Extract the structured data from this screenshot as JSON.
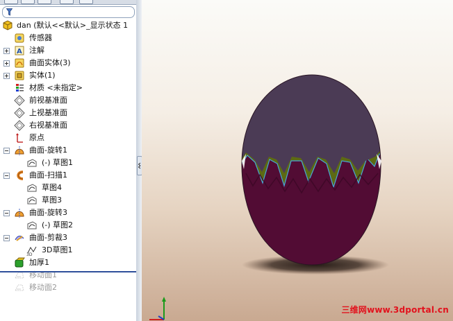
{
  "tree": {
    "root": "dan  (默认<<默认>_显示状态 1",
    "items": [
      {
        "label": "传感器",
        "icon": "sensor-icon",
        "expander": "none",
        "indent": 0
      },
      {
        "label": "注解",
        "icon": "annotation-icon",
        "expander": "plus",
        "indent": 0
      },
      {
        "label": "曲面实体(3)",
        "icon": "surface-bodies-icon",
        "expander": "plus",
        "indent": 0
      },
      {
        "label": "实体(1)",
        "icon": "solid-bodies-icon",
        "expander": "plus",
        "indent": 0
      },
      {
        "label": "材质 <未指定>",
        "icon": "material-icon",
        "expander": "none",
        "indent": 0
      },
      {
        "label": "前视基准面",
        "icon": "plane-icon",
        "expander": "none",
        "indent": 0
      },
      {
        "label": "上视基准面",
        "icon": "plane-icon",
        "expander": "none",
        "indent": 0
      },
      {
        "label": "右视基准面",
        "icon": "plane-icon",
        "expander": "none",
        "indent": 0
      },
      {
        "label": "原点",
        "icon": "origin-icon",
        "expander": "none",
        "indent": 0
      },
      {
        "label": "曲面-旋转1",
        "icon": "surface-revolve-icon",
        "expander": "minus",
        "indent": 0
      },
      {
        "label": "(-) 草图1",
        "icon": "sketch-icon",
        "expander": "none",
        "indent": 1
      },
      {
        "label": "曲面-扫描1",
        "icon": "surface-sweep-icon",
        "expander": "minus",
        "indent": 0
      },
      {
        "label": "草图4",
        "icon": "sketch-icon",
        "expander": "none",
        "indent": 1
      },
      {
        "label": "草图3",
        "icon": "sketch-icon",
        "expander": "none",
        "indent": 1
      },
      {
        "label": "曲面-旋转3",
        "icon": "surface-revolve-icon",
        "expander": "minus",
        "indent": 0
      },
      {
        "label": "(-) 草图2",
        "icon": "sketch-icon",
        "expander": "none",
        "indent": 1
      },
      {
        "label": "曲面-剪裁3",
        "icon": "surface-trim-icon",
        "expander": "minus",
        "indent": 0
      },
      {
        "label": "3D草图1",
        "icon": "sketch-3d-icon",
        "expander": "none",
        "indent": 1
      },
      {
        "label": "加厚1",
        "icon": "thicken-icon",
        "expander": "none",
        "indent": 0
      },
      {
        "label": "移动面1",
        "icon": "move-face-icon",
        "expander": "none",
        "indent": 0,
        "suppressed": true
      },
      {
        "label": "移动面2",
        "icon": "move-face-icon",
        "expander": "none",
        "indent": 0,
        "suppressed": true
      }
    ]
  },
  "watermark": "三维网www.3dportal.cn",
  "colors": {
    "egg_top": "#4b3b55",
    "egg_bottom": "#520c34",
    "egg_band": "#5d6a13",
    "rollback_bar": "#2e4f9a",
    "watermark": "#e2121d"
  }
}
